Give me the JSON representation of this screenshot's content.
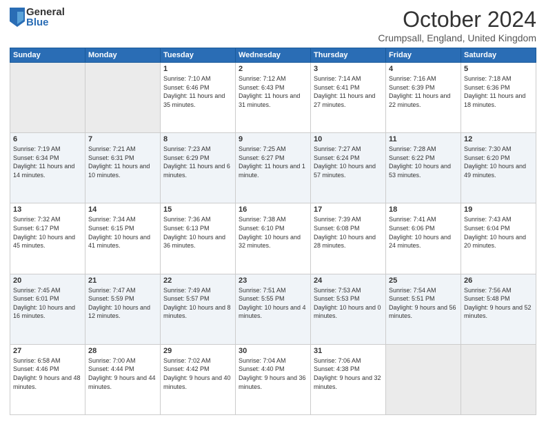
{
  "logo": {
    "general": "General",
    "blue": "Blue"
  },
  "title": "October 2024",
  "location": "Crumpsall, England, United Kingdom",
  "days_of_week": [
    "Sunday",
    "Monday",
    "Tuesday",
    "Wednesday",
    "Thursday",
    "Friday",
    "Saturday"
  ],
  "weeks": [
    [
      {
        "day": "",
        "empty": true
      },
      {
        "day": "",
        "empty": true
      },
      {
        "day": "1",
        "sunrise": "7:10 AM",
        "sunset": "6:46 PM",
        "daylight": "11 hours and 35 minutes."
      },
      {
        "day": "2",
        "sunrise": "7:12 AM",
        "sunset": "6:43 PM",
        "daylight": "11 hours and 31 minutes."
      },
      {
        "day": "3",
        "sunrise": "7:14 AM",
        "sunset": "6:41 PM",
        "daylight": "11 hours and 27 minutes."
      },
      {
        "day": "4",
        "sunrise": "7:16 AM",
        "sunset": "6:39 PM",
        "daylight": "11 hours and 22 minutes."
      },
      {
        "day": "5",
        "sunrise": "7:18 AM",
        "sunset": "6:36 PM",
        "daylight": "11 hours and 18 minutes."
      }
    ],
    [
      {
        "day": "6",
        "sunrise": "7:19 AM",
        "sunset": "6:34 PM",
        "daylight": "11 hours and 14 minutes."
      },
      {
        "day": "7",
        "sunrise": "7:21 AM",
        "sunset": "6:31 PM",
        "daylight": "11 hours and 10 minutes."
      },
      {
        "day": "8",
        "sunrise": "7:23 AM",
        "sunset": "6:29 PM",
        "daylight": "11 hours and 6 minutes."
      },
      {
        "day": "9",
        "sunrise": "7:25 AM",
        "sunset": "6:27 PM",
        "daylight": "11 hours and 1 minute."
      },
      {
        "day": "10",
        "sunrise": "7:27 AM",
        "sunset": "6:24 PM",
        "daylight": "10 hours and 57 minutes."
      },
      {
        "day": "11",
        "sunrise": "7:28 AM",
        "sunset": "6:22 PM",
        "daylight": "10 hours and 53 minutes."
      },
      {
        "day": "12",
        "sunrise": "7:30 AM",
        "sunset": "6:20 PM",
        "daylight": "10 hours and 49 minutes."
      }
    ],
    [
      {
        "day": "13",
        "sunrise": "7:32 AM",
        "sunset": "6:17 PM",
        "daylight": "10 hours and 45 minutes."
      },
      {
        "day": "14",
        "sunrise": "7:34 AM",
        "sunset": "6:15 PM",
        "daylight": "10 hours and 41 minutes."
      },
      {
        "day": "15",
        "sunrise": "7:36 AM",
        "sunset": "6:13 PM",
        "daylight": "10 hours and 36 minutes."
      },
      {
        "day": "16",
        "sunrise": "7:38 AM",
        "sunset": "6:10 PM",
        "daylight": "10 hours and 32 minutes."
      },
      {
        "day": "17",
        "sunrise": "7:39 AM",
        "sunset": "6:08 PM",
        "daylight": "10 hours and 28 minutes."
      },
      {
        "day": "18",
        "sunrise": "7:41 AM",
        "sunset": "6:06 PM",
        "daylight": "10 hours and 24 minutes."
      },
      {
        "day": "19",
        "sunrise": "7:43 AM",
        "sunset": "6:04 PM",
        "daylight": "10 hours and 20 minutes."
      }
    ],
    [
      {
        "day": "20",
        "sunrise": "7:45 AM",
        "sunset": "6:01 PM",
        "daylight": "10 hours and 16 minutes."
      },
      {
        "day": "21",
        "sunrise": "7:47 AM",
        "sunset": "5:59 PM",
        "daylight": "10 hours and 12 minutes."
      },
      {
        "day": "22",
        "sunrise": "7:49 AM",
        "sunset": "5:57 PM",
        "daylight": "10 hours and 8 minutes."
      },
      {
        "day": "23",
        "sunrise": "7:51 AM",
        "sunset": "5:55 PM",
        "daylight": "10 hours and 4 minutes."
      },
      {
        "day": "24",
        "sunrise": "7:53 AM",
        "sunset": "5:53 PM",
        "daylight": "10 hours and 0 minutes."
      },
      {
        "day": "25",
        "sunrise": "7:54 AM",
        "sunset": "5:51 PM",
        "daylight": "9 hours and 56 minutes."
      },
      {
        "day": "26",
        "sunrise": "7:56 AM",
        "sunset": "5:48 PM",
        "daylight": "9 hours and 52 minutes."
      }
    ],
    [
      {
        "day": "27",
        "sunrise": "6:58 AM",
        "sunset": "4:46 PM",
        "daylight": "9 hours and 48 minutes."
      },
      {
        "day": "28",
        "sunrise": "7:00 AM",
        "sunset": "4:44 PM",
        "daylight": "9 hours and 44 minutes."
      },
      {
        "day": "29",
        "sunrise": "7:02 AM",
        "sunset": "4:42 PM",
        "daylight": "9 hours and 40 minutes."
      },
      {
        "day": "30",
        "sunrise": "7:04 AM",
        "sunset": "4:40 PM",
        "daylight": "9 hours and 36 minutes."
      },
      {
        "day": "31",
        "sunrise": "7:06 AM",
        "sunset": "4:38 PM",
        "daylight": "9 hours and 32 minutes."
      },
      {
        "day": "",
        "empty": true
      },
      {
        "day": "",
        "empty": true
      }
    ]
  ]
}
